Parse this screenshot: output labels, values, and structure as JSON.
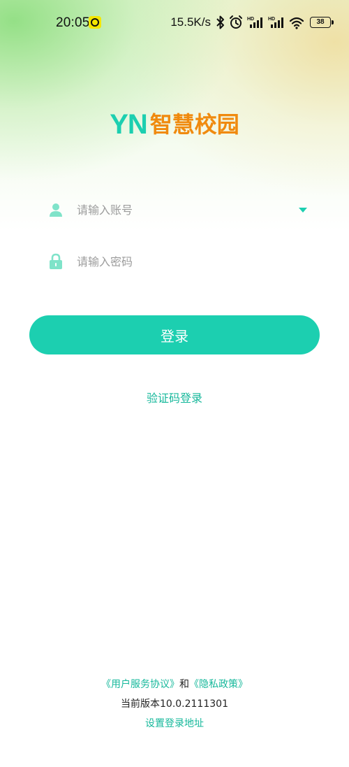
{
  "status_bar": {
    "time": "20:05",
    "network_speed": "15.5K/s",
    "battery": "38",
    "icons": [
      "notification-dot-icon",
      "bluetooth-icon",
      "alarm-icon",
      "hd-signal-icon",
      "hd-signal-icon",
      "wifi-icon",
      "battery-icon"
    ]
  },
  "logo": {
    "mark": "YN",
    "name": "智慧校园"
  },
  "form": {
    "account_placeholder": "请输入账号",
    "password_placeholder": "请输入密码",
    "account_icon": "user-icon",
    "password_icon": "lock-icon",
    "dropdown_icon": "caret-down-icon"
  },
  "login_button": "登录",
  "sms_login_link": "验证码登录",
  "footer": {
    "user_agreement": "《用户服务协议》",
    "and": "和",
    "privacy_policy": "《隐私政策》",
    "version": "当前版本10.0.2111301",
    "set_login_address": "设置登录地址"
  },
  "colors": {
    "accent": "#1ccfb0",
    "accent_text": "#16b89b",
    "logo_orange": "#f08a0e",
    "icon_mint": "#7fe3c9"
  }
}
